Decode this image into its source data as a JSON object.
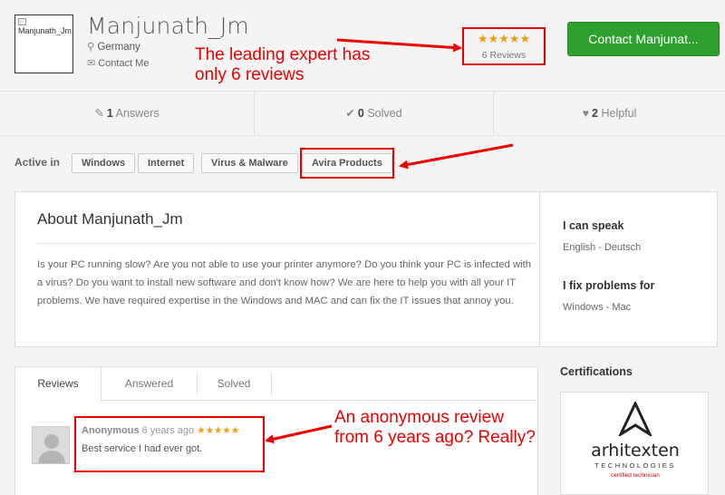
{
  "profile": {
    "avatar_alt": "Manjunath_Jm",
    "name": "Manjunath_Jm",
    "location": "Germany",
    "contact_link": "Contact Me",
    "rating_stars": "★★★★★",
    "rating_value": 5,
    "reviews_count_label": "6 Reviews",
    "contact_button": "Contact Manjunat..."
  },
  "stats": {
    "answers": {
      "value": "1",
      "label": "Answers"
    },
    "solved": {
      "value": "0",
      "label": "Solved"
    },
    "helpful": {
      "value": "2",
      "label": "Helpful"
    }
  },
  "active_in": {
    "label": "Active in",
    "tags": [
      "Windows",
      "Internet",
      "Virus & Malware",
      "Avira Products"
    ]
  },
  "about": {
    "title": "About Manjunath_Jm",
    "text": "Is your PC running slow? Are you not able to use your printer anymore? Do you think your PC is infected with a virus? Do you want to install new software and don't know how? We are here to help you with all your IT problems. We have required expertise in the Windows and MAC and can fix the IT issues that annoy you.",
    "speak_heading": "I can speak",
    "speak_value": "English - Deutsch",
    "fix_heading": "I fix problems for",
    "fix_value": "Windows - Mac"
  },
  "reviews": {
    "tabs": [
      "Reviews",
      "Answered",
      "Solved"
    ],
    "active_tab": "Reviews",
    "items": [
      {
        "author": "Anonymous",
        "time": "6 years ago",
        "stars": "★★★★★",
        "text": "Best service I had ever got."
      }
    ]
  },
  "certifications": {
    "heading": "Certifications",
    "brand": "arhitexten",
    "sub": "TECHNOLOGIES",
    "badge": "certified technician"
  },
  "annotations": {
    "note1_line1": "The leading expert has",
    "note1_line2": "only 6 reviews",
    "note2_line1": "An anonymous review",
    "note2_line2": "from 6 years ago? Really?"
  },
  "colors": {
    "accent_green": "#2ea02e",
    "star": "#f39c12",
    "annotation_red": "#e00000"
  }
}
